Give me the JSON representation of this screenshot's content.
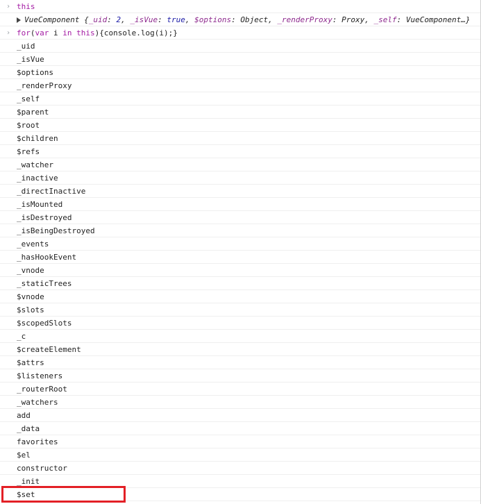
{
  "console": {
    "input1": {
      "prompt": "›",
      "command": "this"
    },
    "output1": {
      "class_name": "VueComponent",
      "open": "{",
      "entries": [
        {
          "key": "_uid",
          "value": "2",
          "vtype": "num"
        },
        {
          "key": "_isVue",
          "value": "true",
          "vtype": "bool"
        },
        {
          "key": "$options",
          "value": "Object",
          "vtype": "obj"
        },
        {
          "key": "_renderProxy",
          "value": "Proxy",
          "vtype": "obj"
        },
        {
          "key": "_self",
          "value": "VueComponent…}",
          "vtype": "obj"
        }
      ]
    },
    "input2": {
      "prompt": "›",
      "kw_for": "for",
      "paren_open": "(",
      "kw_var": "var",
      "var_name": " i ",
      "kw_in": "in",
      "space": " ",
      "kw_this": "this",
      "rest": "){console.log(i);}"
    },
    "logged": [
      "_uid",
      "_isVue",
      "$options",
      "_renderProxy",
      "_self",
      "$parent",
      "$root",
      "$children",
      "$refs",
      "_watcher",
      "_inactive",
      "_directInactive",
      "_isMounted",
      "_isDestroyed",
      "_isBeingDestroyed",
      "_events",
      "_hasHookEvent",
      "_vnode",
      "_staticTrees",
      "$vnode",
      "$slots",
      "$scopedSlots",
      "_c",
      "$createElement",
      "$attrs",
      "$listeners",
      "_routerRoot",
      "_watchers",
      "add",
      "_data",
      "favorites",
      "$el",
      "constructor",
      "_init",
      "$set"
    ]
  },
  "colors": {
    "highlight_border": "#e32026",
    "keyword": "#a31aa3"
  }
}
